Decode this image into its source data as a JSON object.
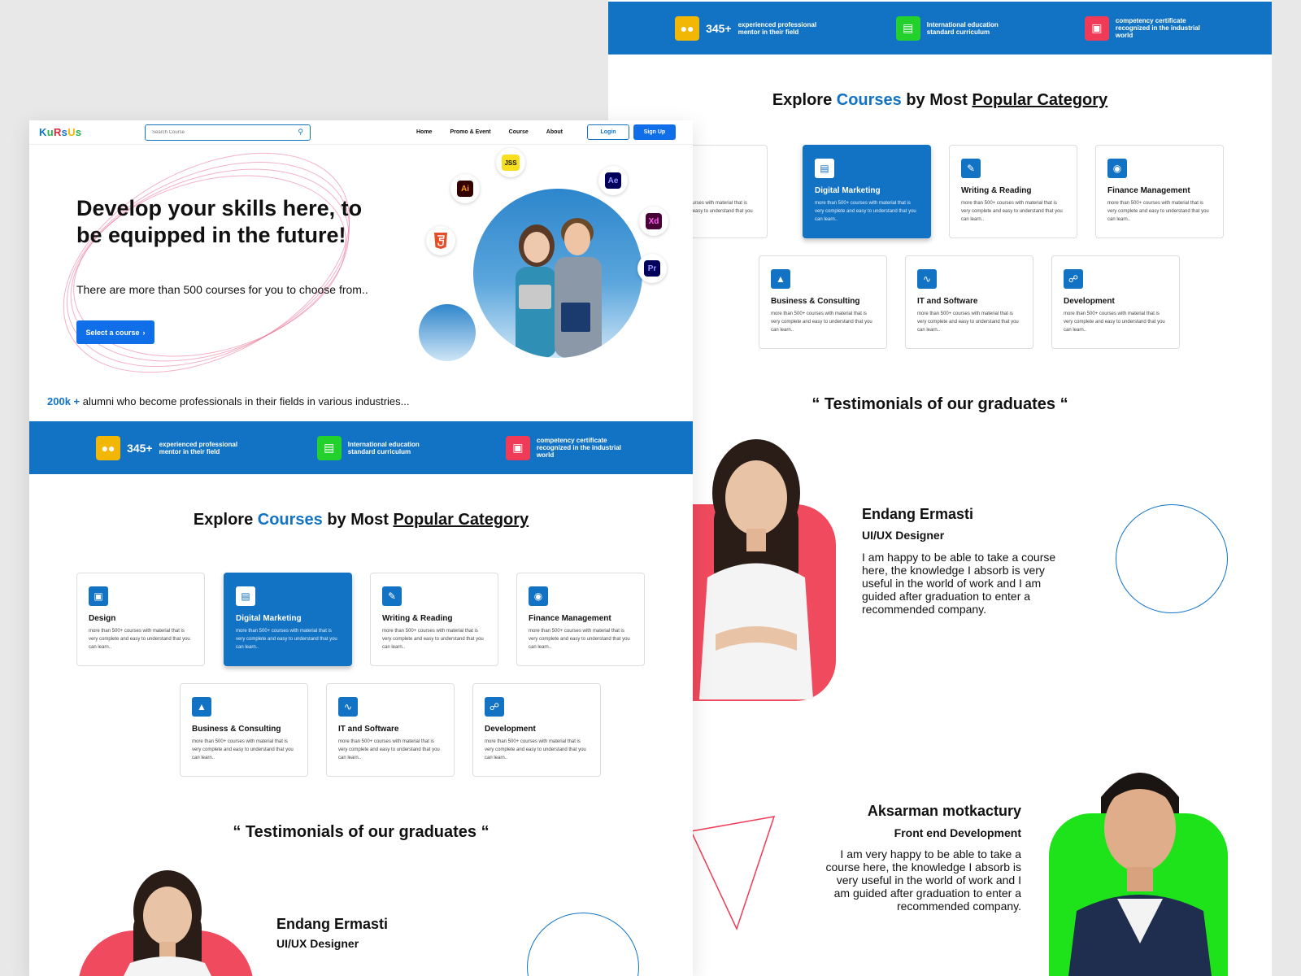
{
  "brand": {
    "letters": [
      "K",
      "u",
      "R",
      "s",
      "U",
      "s"
    ]
  },
  "nav": {
    "search_placeholder": "Search Course",
    "links": [
      "Home",
      "Promo & Event",
      "Course",
      "About"
    ],
    "login": "Login",
    "signup": "Sign Up"
  },
  "hero": {
    "title": "Develop your skills here, to be equipped in the future!",
    "subtitle": "There are more than 500 courses for you to choose from..",
    "cta": "Select a course",
    "tools": [
      "JSS",
      "Ai",
      "Ae",
      "Xd",
      "Pr"
    ],
    "alumni_count": "200k +",
    "alumni_text": "alumni who become professionals in their fields in various industries..."
  },
  "stats": [
    {
      "icon": "people-icon",
      "number": "345+",
      "text": "experienced professional mentor in their field",
      "color": "#f2b705"
    },
    {
      "icon": "book-icon",
      "number": "",
      "text": "International education standard curriculum",
      "color": "#22d12c"
    },
    {
      "icon": "certificate-icon",
      "number": "",
      "text": "competency certificate recognized in the industrial world",
      "color": "#ef3b57"
    }
  ],
  "explore": {
    "pre": "Explore",
    "highlight": "Courses",
    "mid": "by Most",
    "underlined": "Popular Category"
  },
  "categories": [
    {
      "title": "Design",
      "desc": "more than 500+ courses with material that is very complete and easy to understand that you can learn..",
      "icon": "design-icon"
    },
    {
      "title": "Digital Marketing",
      "desc": "more than 500+ courses with material that is very complete and easy to understand that you can learn..",
      "icon": "presentation-icon"
    },
    {
      "title": "Writing & Reading",
      "desc": "more than 500+ courses with material that is very complete and easy to understand that you can learn..",
      "icon": "pencil-icon"
    },
    {
      "title": "Finance Management",
      "desc": "more than 500+ courses with material that is very complete and easy to understand that you can learn..",
      "icon": "money-icon"
    },
    {
      "title": "Business & Consulting",
      "desc": "more than 500+ courses with material that is very complete and easy to understand that you can learn..",
      "icon": "chart-icon"
    },
    {
      "title": "IT and Software",
      "desc": "more than 500+ courses with material that is very complete and easy to understand that you can learn..",
      "icon": "pulse-icon"
    },
    {
      "title": "Development",
      "desc": "more than 500+ courses with material that is very complete and easy to understand that you can learn..",
      "icon": "branch-icon"
    }
  ],
  "testimonials": {
    "title": "“ Testimonials of our graduates “",
    "items": [
      {
        "name": "Endang Ermasti",
        "role": "UI/UX Designer",
        "text": "I am happy to be able to take a course here, the knowledge I absorb is very useful in the world of work and I am guided after graduation to enter a recommended company."
      },
      {
        "name": "Aksarman motkactury",
        "role": "Front end Development",
        "text": "I am very happy to be able to take a course here, the knowledge I absorb is very useful in the world of work and I am guided after graduation to enter a recommended company."
      }
    ]
  },
  "colors": {
    "primary": "#1273c4",
    "button": "#0f6ee8",
    "red": "#ef3b57",
    "green": "#22e01e"
  }
}
